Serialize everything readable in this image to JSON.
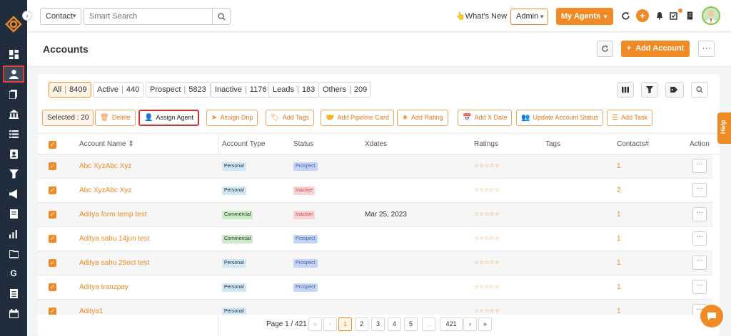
{
  "topbar": {
    "entity_select": "Contact",
    "search_placeholder": "Smart Search",
    "whats_new": "What's New",
    "role_select": "Admin",
    "my_agents": "My Agents"
  },
  "header": {
    "title": "Accounts",
    "add_account": "Add Account"
  },
  "filters": [
    {
      "label": "All",
      "count": "8409"
    },
    {
      "label": "Active",
      "count": "440"
    },
    {
      "label": "Prospect",
      "count": "5823"
    },
    {
      "label": "Inactive",
      "count": "1176"
    },
    {
      "label": "Leads",
      "count": "183"
    },
    {
      "label": "Others",
      "count": "209"
    }
  ],
  "actions": {
    "selected": "Selected : 20",
    "delete": "Delete",
    "assign_agent": "Assign Agent",
    "assign_drip": "Assign Drip",
    "add_tags": "Add Tags",
    "add_pipeline_card": "Add Pipeline Card",
    "add_rating": "Add Rating",
    "add_x_date": "Add X Date",
    "update_account_status": "Update Account Status",
    "add_task": "Add Task"
  },
  "table": {
    "columns": {
      "name": "Account Name",
      "type": "Account Type",
      "status": "Status",
      "xdates": "Xdates",
      "ratings": "Ratings",
      "tags": "Tags",
      "contacts": "Contacts#",
      "action": "Action"
    },
    "rows": [
      {
        "name": "Abc XyzAbc Xyz",
        "type": "Personal",
        "status": "Prospect",
        "xdate": "",
        "contacts": "1"
      },
      {
        "name": "Abc XyzAbc Xyz",
        "type": "Personal",
        "status": "Inactive",
        "xdate": "",
        "contacts": "2"
      },
      {
        "name": "Aditya form temp test",
        "type": "Commercial",
        "status": "Inactive",
        "xdate": "Mar 25, 2023",
        "contacts": "1"
      },
      {
        "name": "Aditya sahu 14jun test",
        "type": "Commercial",
        "status": "Prospect",
        "xdate": "",
        "contacts": "1"
      },
      {
        "name": "Aditya sahu 29oct test",
        "type": "Personal",
        "status": "Prospect",
        "xdate": "",
        "contacts": "1"
      },
      {
        "name": "Aditya tranzpay",
        "type": "Personal",
        "status": "Prospect",
        "xdate": "",
        "contacts": "1"
      },
      {
        "name": "Aditya1",
        "type": "Personal",
        "status": "",
        "xdate": "",
        "contacts": "1"
      }
    ],
    "stars": "☆☆☆☆☆",
    "action_dots": "···"
  },
  "pagination": {
    "label": "Page 1 / 421",
    "first": "«",
    "prev": "‹",
    "pages": [
      "1",
      "2",
      "3",
      "4",
      "5",
      "...",
      "421"
    ],
    "next": "›",
    "last": "»"
  },
  "help": "Help",
  "colors": {
    "accent": "#f08a24",
    "sidebar": "#1f2d3d",
    "highlight": "#d32f2f"
  }
}
